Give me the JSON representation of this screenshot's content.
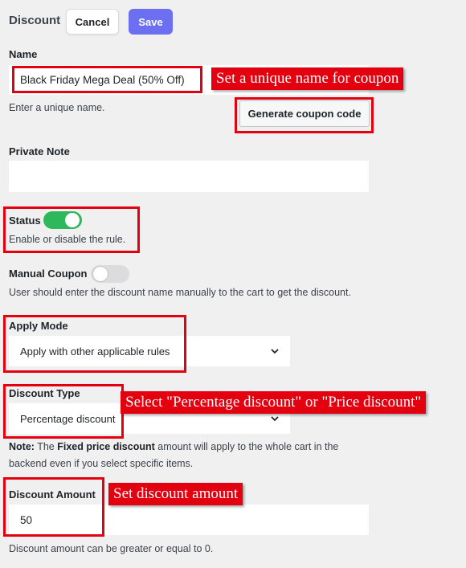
{
  "header": {
    "title": "Discount",
    "cancel_label": "Cancel",
    "save_label": "Save",
    "accent_color": "#6b6ff0"
  },
  "name": {
    "label": "Name",
    "value": "Black Friday Mega Deal (50% Off)",
    "help": "Enter a unique name.",
    "generate_label": "Generate coupon code"
  },
  "private_note": {
    "label": "Private Note",
    "value": ""
  },
  "status": {
    "label": "Status",
    "enabled": true,
    "help": "Enable or disable the rule.",
    "on_color": "#2eb85c"
  },
  "manual_coupon": {
    "label": "Manual Coupon",
    "enabled": false,
    "help": "User should enter the discount name manually to the cart to get the discount."
  },
  "apply_mode": {
    "label": "Apply Mode",
    "selected": "Apply with other applicable rules"
  },
  "discount_type": {
    "label": "Discount Type",
    "selected": "Percentage discount",
    "note_prefix": "Note:",
    "note_text_1": " The ",
    "note_emphasis": "Fixed price discount",
    "note_text_2": " amount will apply to the whole cart in the backend even if you select specific items."
  },
  "discount_amount": {
    "label": "Discount Amount",
    "value": "50",
    "help": "Discount amount can be greater or equal to 0."
  },
  "annotations": {
    "name_callout": "Set a unique name for coupon",
    "type_callout": "Select \"Percentage discount\" or \"Price discount\"",
    "amount_callout": "Set discount amount",
    "highlight_color": "#e3000f"
  }
}
